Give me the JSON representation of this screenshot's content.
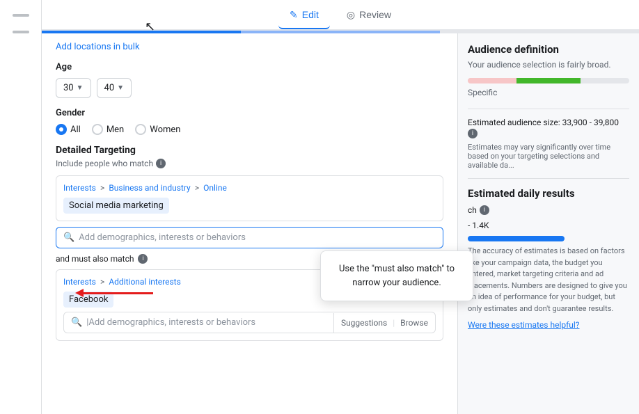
{
  "tabs": {
    "edit_label": "Edit",
    "review_label": "Review",
    "edit_icon": "✎",
    "review_icon": "👁"
  },
  "form": {
    "add_locations_link": "Add locations in bulk",
    "age_label": "Age",
    "age_from": "30",
    "age_to": "40",
    "gender_label": "Gender",
    "gender_options": [
      "All",
      "Men",
      "Women"
    ],
    "gender_selected": "All",
    "detailed_targeting_title": "Detailed Targeting",
    "include_people_label": "Include people who match",
    "interests_breadcrumb1": "Interests",
    "interests_breadcrumb2": "Business and industry",
    "interests_breadcrumb3": "Online",
    "tag_label": "Social media marketing",
    "search_placeholder": "Add demographics, interests or behaviors",
    "must_match_label": "and must also match",
    "interests2_breadcrumb1": "Interests",
    "interests2_breadcrumb2": "Additional interests",
    "tag2_label": "Facebook",
    "bottom_search_placeholder": "|Add demographics, interests or behaviors",
    "suggestions_label": "Suggestions",
    "browse_label": "Browse"
  },
  "right_panel": {
    "audience_def_title": "Audience definition",
    "audience_def_sub": "Your audience selection is fairly broad.",
    "specific_label": "Specific",
    "estimated_size_label": "Estimated audience size: 33,900 - 39,800",
    "info_icon_label": "ℹ",
    "est_note": "Estimates may vary significantly over time based on your targeting selections and available da...",
    "daily_results_title": "Estimated daily results",
    "reach_label": "ch",
    "reach_value": "- 1.4K",
    "accuracy_note": "The accuracy of estimates is based on factors like your campaign data, the budget you entered, market targeting criteria and ad placements. Numbers are designed to give you an idea of performance for your budget, but only estimates and don't guarantee results.",
    "helpful_link": "Were these estimates helpful?"
  },
  "tooltip": {
    "text": "Use the \"must also match\" to narrow your audience."
  },
  "cursor": "↖"
}
